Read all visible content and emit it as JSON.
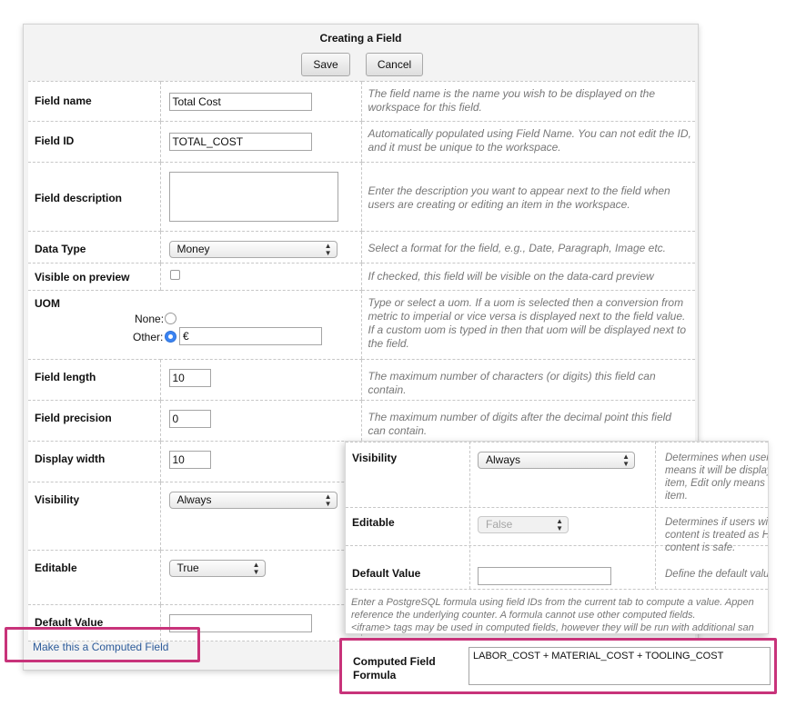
{
  "dialog": {
    "title": "Creating a Field",
    "save_label": "Save",
    "cancel_label": "Cancel"
  },
  "fields": {
    "field_name": {
      "label": "Field name",
      "value": "Total Cost",
      "hint": "The field name is the name you wish to be displayed on the workspace for this field."
    },
    "field_id": {
      "label": "Field ID",
      "value": "TOTAL_COST",
      "hint": "Automatically populated using Field Name. You can not edit the ID, and it must be unique to the workspace."
    },
    "field_description": {
      "label": "Field description",
      "value": "",
      "hint": "Enter the description you want to appear next to the field when users are creating or editing an item in the workspace."
    },
    "data_type": {
      "label": "Data Type",
      "value": "Money",
      "hint": "Select a format for the field, e.g., Date, Paragraph, Image etc."
    },
    "visible_on_preview": {
      "label": "Visible on preview",
      "checked": false,
      "hint": "If checked, this field will be visible on the data-card preview"
    },
    "uom": {
      "label": "UOM",
      "none_label": "None:",
      "other_label": "Other:",
      "selected": "Other",
      "other_value": "€",
      "hint": "Type or select a uom. If a uom is selected then a conversion from metric to imperial or vice versa is displayed next to the field value. If a custom uom is typed in then that uom will be displayed next to the field."
    },
    "field_length": {
      "label": "Field length",
      "value": "10",
      "hint": "The maximum number of characters (or digits) this field can contain."
    },
    "field_precision": {
      "label": "Field precision",
      "value": "0",
      "hint": "The maximum number of digits after the decimal point this field can contain."
    },
    "display_width": {
      "label": "Display width",
      "value": "10"
    },
    "visibility": {
      "label": "Visibility",
      "value": "Always"
    },
    "editable": {
      "label": "Editable",
      "value": "True"
    },
    "default_value": {
      "label": "Default Value",
      "value": ""
    }
  },
  "computed_link": "Make this a Computed Field",
  "inset": {
    "visibility": {
      "label": "Visibility",
      "value": "Always",
      "hint_lines": [
        "Determines when user",
        "means it will be display",
        "item, Edit only means i",
        "item."
      ]
    },
    "editable": {
      "label": "Editable",
      "value": "False",
      "hint_lines": [
        "Determines if users wi",
        "content is treated as H",
        "content is safe."
      ]
    },
    "default_value": {
      "label": "Default Value",
      "value": "",
      "hint": "Define the default valu"
    },
    "note_lines": [
      "Enter a PostgreSQL formula using field IDs from the current tab to compute a value. Appen",
      "reference the underlying counter. A formula cannot use other computed fields.",
      "<iframe> tags may be used in computed fields, however they will be run with additional san"
    ],
    "formula_label": "Computed Field Formula",
    "formula_value": "LABOR_COST + MATERIAL_COST + TOOLING_COST"
  },
  "colors": {
    "highlight": "#c8337a",
    "link": "#2d5b9a",
    "radio_selected": "#3b84f2"
  }
}
